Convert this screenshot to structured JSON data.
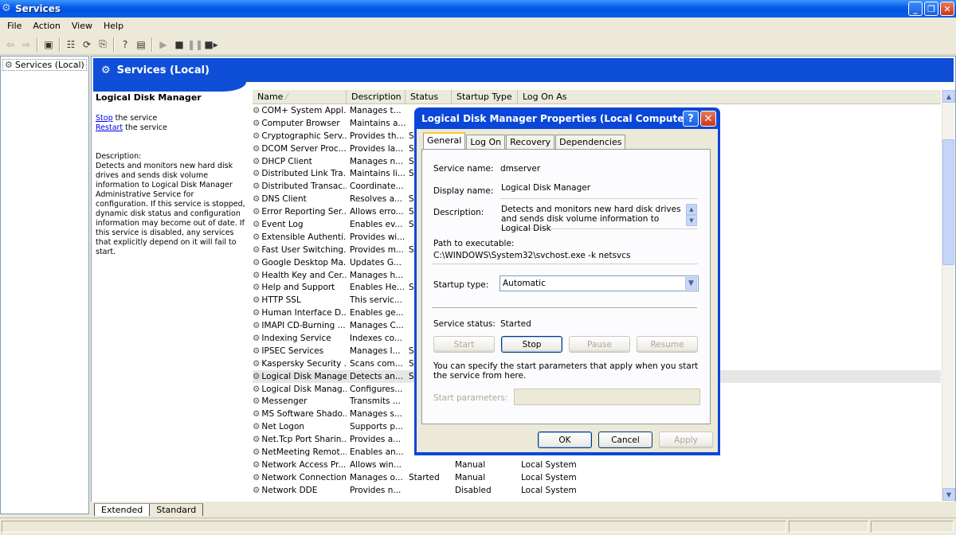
{
  "window": {
    "title": "Services",
    "minimize": "_",
    "restore": "❐",
    "close": "✕"
  },
  "menu": [
    "File",
    "Action",
    "View",
    "Help"
  ],
  "toolbar": {
    "icons": [
      "back-icon",
      "forward-icon",
      "show-hide-tree-icon",
      "properties-icon",
      "refresh-icon",
      "export-list-icon",
      "help-icon",
      "console-view-icon",
      "play-icon",
      "stop-icon",
      "pause-icon",
      "restart-icon"
    ]
  },
  "tree": {
    "item": "Services (Local)"
  },
  "pane": {
    "header": "Services (Local)",
    "selected_title": "Logical Disk Manager",
    "stop_link": "Stop",
    "stop_rest": " the service",
    "restart_link": "Restart",
    "restart_rest": " the service",
    "description_label": "Description:",
    "description_text": "Detects and monitors new hard disk drives and sends disk volume information to Logical Disk Manager Administrative Service for configuration. If this service is stopped, dynamic disk status and configuration information may become out of date. If this service is disabled, any services that explicitly depend on it will fail to start."
  },
  "columns": [
    "Name",
    "Description",
    "Status",
    "Startup Type",
    "Log On As"
  ],
  "services": [
    {
      "name": "COM+ System Appl...",
      "desc": "Manages t...",
      "status": "",
      "startup": "",
      "logon": ""
    },
    {
      "name": "Computer Browser",
      "desc": "Maintains a...",
      "status": "",
      "startup": "",
      "logon": ""
    },
    {
      "name": "Cryptographic Serv...",
      "desc": "Provides th...",
      "status": "S",
      "startup": "",
      "logon": ""
    },
    {
      "name": "DCOM Server Proc...",
      "desc": "Provides la...",
      "status": "S",
      "startup": "",
      "logon": ""
    },
    {
      "name": "DHCP Client",
      "desc": "Manages n...",
      "status": "S",
      "startup": "",
      "logon": ""
    },
    {
      "name": "Distributed Link Tra...",
      "desc": "Maintains li...",
      "status": "S",
      "startup": "",
      "logon": ""
    },
    {
      "name": "Distributed Transac...",
      "desc": "Coordinate...",
      "status": "",
      "startup": "",
      "logon": ""
    },
    {
      "name": "DNS Client",
      "desc": "Resolves a...",
      "status": "S",
      "startup": "",
      "logon": ""
    },
    {
      "name": "Error Reporting Ser...",
      "desc": "Allows erro...",
      "status": "S",
      "startup": "",
      "logon": ""
    },
    {
      "name": "Event Log",
      "desc": "Enables ev...",
      "status": "S",
      "startup": "",
      "logon": ""
    },
    {
      "name": "Extensible Authenti...",
      "desc": "Provides wi...",
      "status": "",
      "startup": "",
      "logon": ""
    },
    {
      "name": "Fast User Switching...",
      "desc": "Provides m...",
      "status": "S",
      "startup": "",
      "logon": ""
    },
    {
      "name": "Google Desktop Ma...",
      "desc": "Updates G...",
      "status": "",
      "startup": "",
      "logon": ""
    },
    {
      "name": "Health Key and Cer...",
      "desc": "Manages h...",
      "status": "",
      "startup": "",
      "logon": ""
    },
    {
      "name": "Help and Support",
      "desc": "Enables He...",
      "status": "S",
      "startup": "",
      "logon": ""
    },
    {
      "name": "HTTP SSL",
      "desc": "This servic...",
      "status": "",
      "startup": "",
      "logon": ""
    },
    {
      "name": "Human Interface D...",
      "desc": "Enables ge...",
      "status": "",
      "startup": "",
      "logon": ""
    },
    {
      "name": "IMAPI CD-Burning ...",
      "desc": "Manages C...",
      "status": "",
      "startup": "",
      "logon": ""
    },
    {
      "name": "Indexing Service",
      "desc": "Indexes co...",
      "status": "",
      "startup": "",
      "logon": ""
    },
    {
      "name": "IPSEC Services",
      "desc": "Manages I...",
      "status": "S",
      "startup": "",
      "logon": ""
    },
    {
      "name": "Kaspersky Security ...",
      "desc": "Scans com...",
      "status": "S",
      "startup": "",
      "logon": ""
    },
    {
      "name": "Logical Disk Manager",
      "desc": "Detects an...",
      "status": "S",
      "startup": "",
      "logon": ""
    },
    {
      "name": "Logical Disk Manag...",
      "desc": "Configures...",
      "status": "",
      "startup": "",
      "logon": ""
    },
    {
      "name": "Messenger",
      "desc": "Transmits ...",
      "status": "",
      "startup": "",
      "logon": ""
    },
    {
      "name": "MS Software Shado...",
      "desc": "Manages s...",
      "status": "",
      "startup": "",
      "logon": ""
    },
    {
      "name": "Net Logon",
      "desc": "Supports p...",
      "status": "",
      "startup": "",
      "logon": ""
    },
    {
      "name": "Net.Tcp Port Sharin...",
      "desc": "Provides a...",
      "status": "",
      "startup": "",
      "logon": ""
    },
    {
      "name": "NetMeeting Remot...",
      "desc": "Enables an...",
      "status": "",
      "startup": "",
      "logon": ""
    },
    {
      "name": "Network Access Pr...",
      "desc": "Allows win...",
      "status": "",
      "startup": "Manual",
      "logon": "Local System"
    },
    {
      "name": "Network Connections",
      "desc": "Manages o...",
      "status": "Started",
      "startup": "Manual",
      "logon": "Local System"
    },
    {
      "name": "Network DDE",
      "desc": "Provides n...",
      "status": "",
      "startup": "Disabled",
      "logon": "Local System"
    }
  ],
  "selected_index": 21,
  "bottom_tabs": [
    "Extended",
    "Standard"
  ],
  "dialog": {
    "title": "Logical Disk Manager Properties (Local Computer)",
    "help": "?",
    "close": "✕",
    "tabs": [
      "General",
      "Log On",
      "Recovery",
      "Dependencies"
    ],
    "service_name_label": "Service name:",
    "service_name": "dmserver",
    "display_name_label": "Display name:",
    "display_name": "Logical Disk Manager",
    "description_label": "Description:",
    "description": "Detects and monitors new hard disk drives and sends disk volume information to Logical Disk",
    "path_label": "Path to executable:",
    "path": "C:\\WINDOWS\\System32\\svchost.exe -k netsvcs",
    "startup_label": "Startup type:",
    "startup_value": "Automatic",
    "status_label": "Service status:",
    "status_value": "Started",
    "start_btn": "Start",
    "stop_btn": "Stop",
    "pause_btn": "Pause",
    "resume_btn": "Resume",
    "hint": "You can specify the start parameters that apply when you start the service from here.",
    "params_label": "Start parameters:",
    "ok": "OK",
    "cancel": "Cancel",
    "apply": "Apply"
  }
}
